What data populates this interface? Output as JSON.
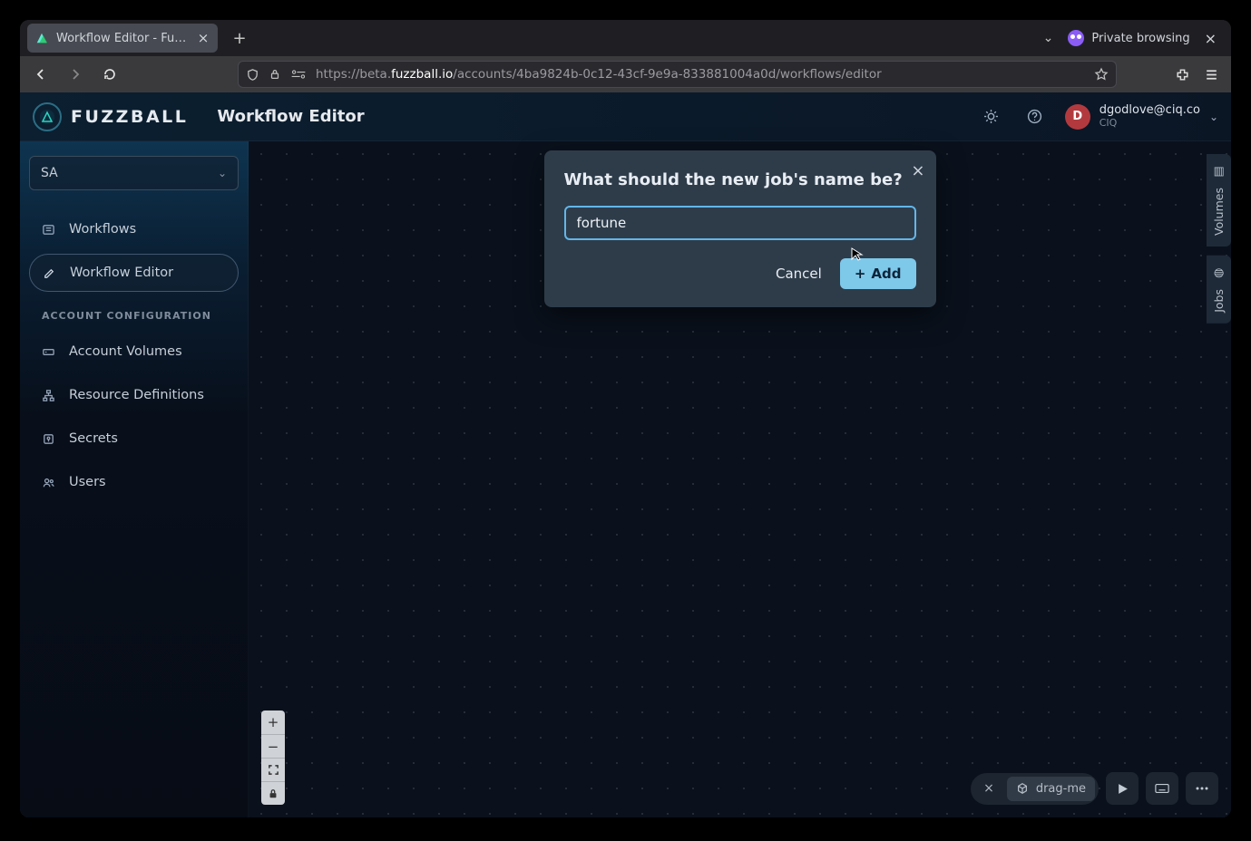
{
  "browser": {
    "tab_title": "Workflow Editor - Fuzzba",
    "private_label": "Private browsing",
    "url_prefix": "https://beta.",
    "url_host": "fuzzball.io",
    "url_path": "/accounts/4ba9824b-0c12-43cf-9e9a-833881004a0d/workflows/editor"
  },
  "app": {
    "brand": "FUZZBALL",
    "page_title": "Workflow Editor",
    "user_email": "dgodlove@ciq.co",
    "user_org": "CIQ",
    "avatar_initial": "D",
    "account_selector": "SA",
    "sidebar": {
      "workflows": "Workflows",
      "editor": "Workflow Editor",
      "section": "ACCOUNT CONFIGURATION",
      "volumes": "Account Volumes",
      "resources": "Resource Definitions",
      "secrets": "Secrets",
      "users": "Users"
    },
    "side_tabs": {
      "volumes": "Volumes",
      "jobs": "Jobs"
    },
    "drag_label": "drag-me"
  },
  "modal": {
    "title": "What should the new job's name be?",
    "value": "fortune",
    "cancel": "Cancel",
    "add": "Add"
  }
}
